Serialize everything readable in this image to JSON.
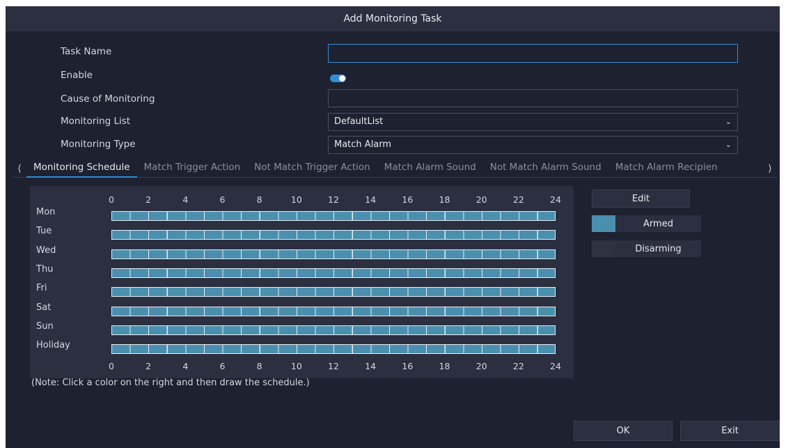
{
  "dialog": {
    "title": "Add Monitoring Task"
  },
  "form": {
    "task_name": {
      "label": "Task Name",
      "value": ""
    },
    "enable": {
      "label": "Enable",
      "on": true
    },
    "cause": {
      "label": "Cause of Monitoring",
      "value": ""
    },
    "monitoring_list": {
      "label": "Monitoring List",
      "value": "DefaultList"
    },
    "monitoring_type": {
      "label": "Monitoring Type",
      "value": "Match Alarm"
    }
  },
  "tabs": {
    "prev_icon": "chevron-left-icon",
    "next_icon": "chevron-right-icon",
    "items": [
      {
        "label": "Monitoring Schedule",
        "active": true
      },
      {
        "label": "Match Trigger Action",
        "active": false
      },
      {
        "label": "Not Match Trigger Action",
        "active": false
      },
      {
        "label": "Match Alarm Sound",
        "active": false
      },
      {
        "label": "Not Match Alarm Sound",
        "active": false
      },
      {
        "label": "Match Alarm Recipien",
        "active": false
      }
    ]
  },
  "schedule": {
    "hours": [
      "0",
      "2",
      "4",
      "6",
      "8",
      "10",
      "12",
      "14",
      "16",
      "18",
      "20",
      "22",
      "24"
    ],
    "days": [
      "Mon",
      "Tue",
      "Wed",
      "Thu",
      "Fri",
      "Sat",
      "Sun",
      "Holiday"
    ],
    "armed_color": "#4b8fae",
    "disarmed_color": "#2f3240",
    "note": "(Note: Click a color on the right and then draw the schedule.)"
  },
  "legend": {
    "edit_label": "Edit",
    "armed_label": "Armed",
    "disarming_label": "Disarming"
  },
  "footer": {
    "ok_label": "OK",
    "exit_label": "Exit"
  },
  "colors": {
    "accent": "#2e8fd8",
    "panel": "#2b2f3f",
    "background": "#1e2130"
  }
}
